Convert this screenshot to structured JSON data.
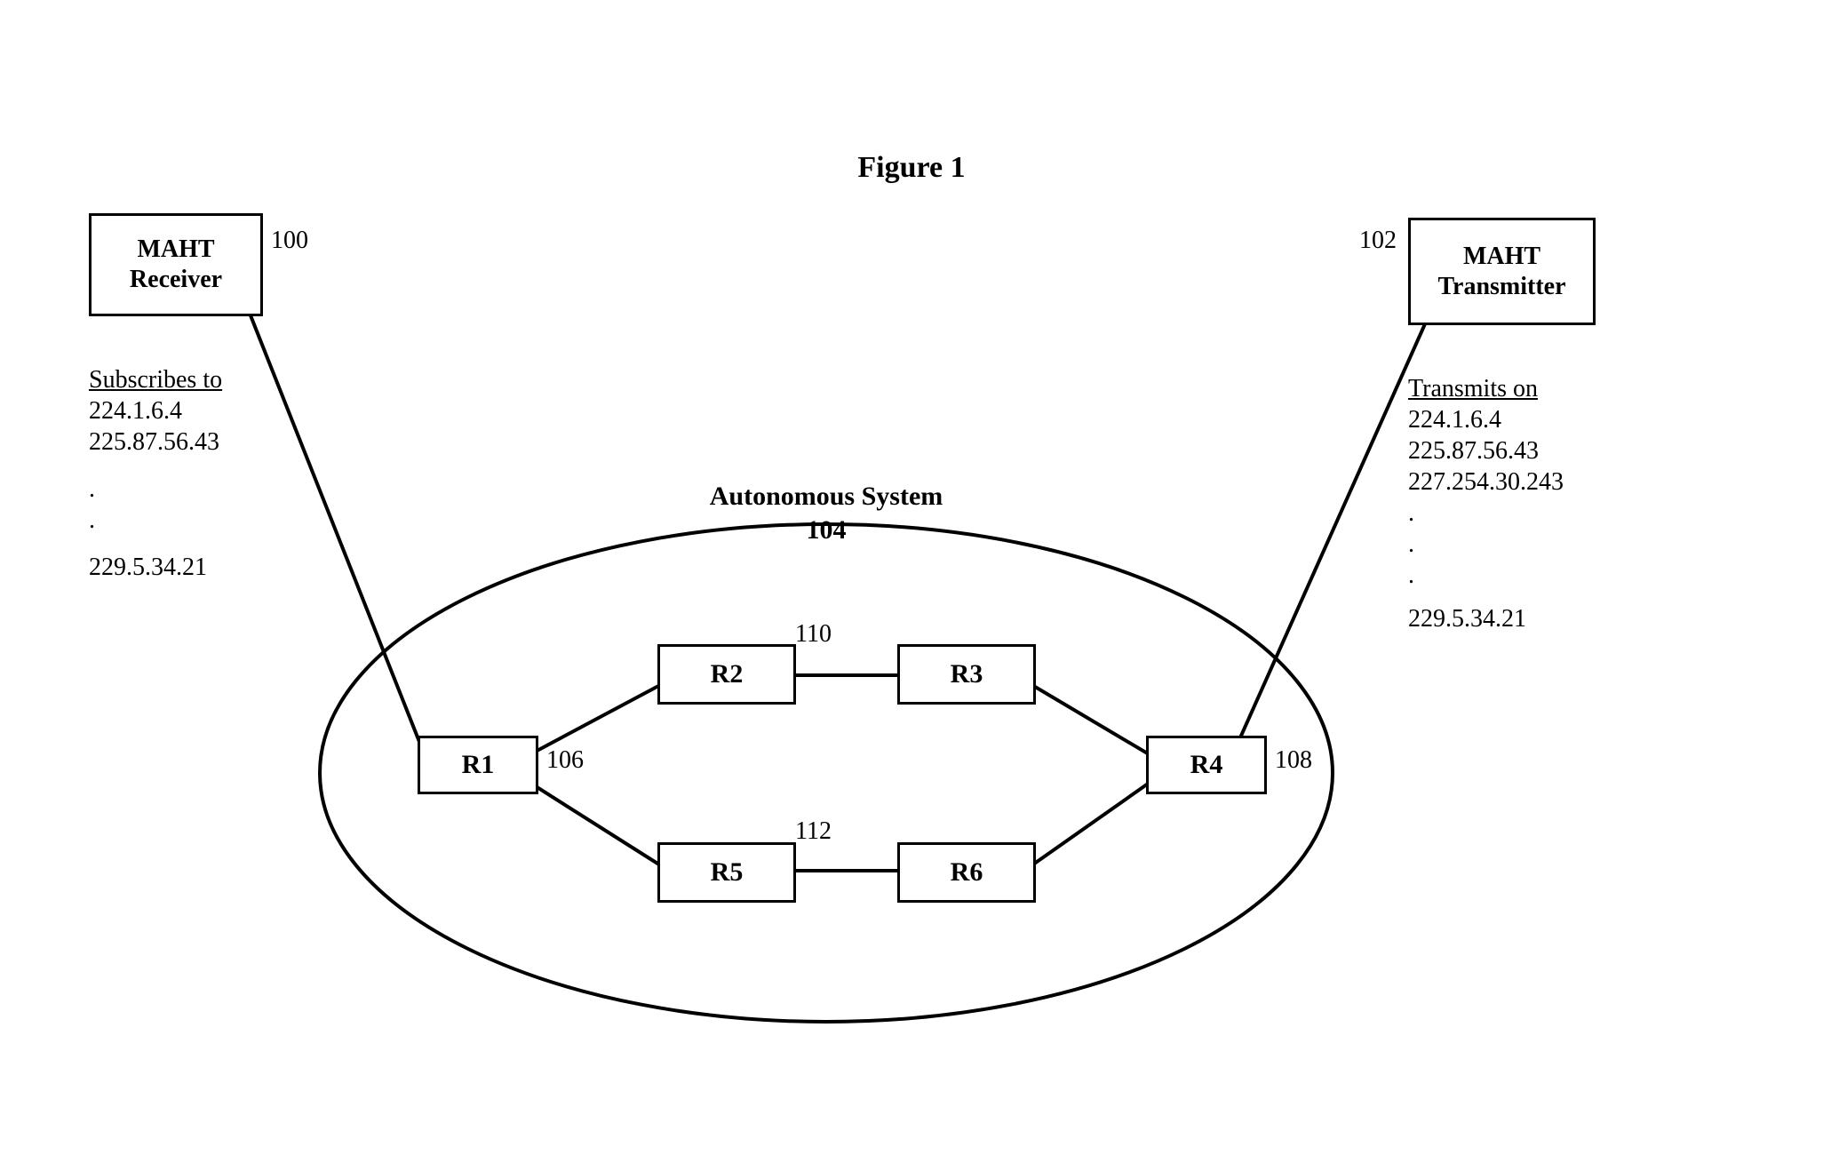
{
  "title": "Figure 1",
  "autonomous_system": {
    "label": "Autonomous System",
    "ref": "104"
  },
  "receiver": {
    "name": "MAHT\nReceiver",
    "ref": "100",
    "header": "Subscribes to",
    "addresses": [
      "224.1.6.4",
      "225.87.56.43"
    ],
    "tail": "229.5.34.21"
  },
  "transmitter": {
    "name": "MAHT\nTransmitter",
    "ref": "102",
    "header": "Transmits on",
    "addresses": [
      "224.1.6.4",
      "225.87.56.43",
      "227.254.30.243"
    ],
    "tail": "229.5.34.21"
  },
  "routers": {
    "R1": {
      "label": "R1",
      "ref": "106"
    },
    "R2": {
      "label": "R2",
      "ref": "110"
    },
    "R3": {
      "label": "R3"
    },
    "R4": {
      "label": "R4",
      "ref": "108"
    },
    "R5": {
      "label": "R5",
      "ref": "112"
    },
    "R6": {
      "label": "R6"
    }
  }
}
